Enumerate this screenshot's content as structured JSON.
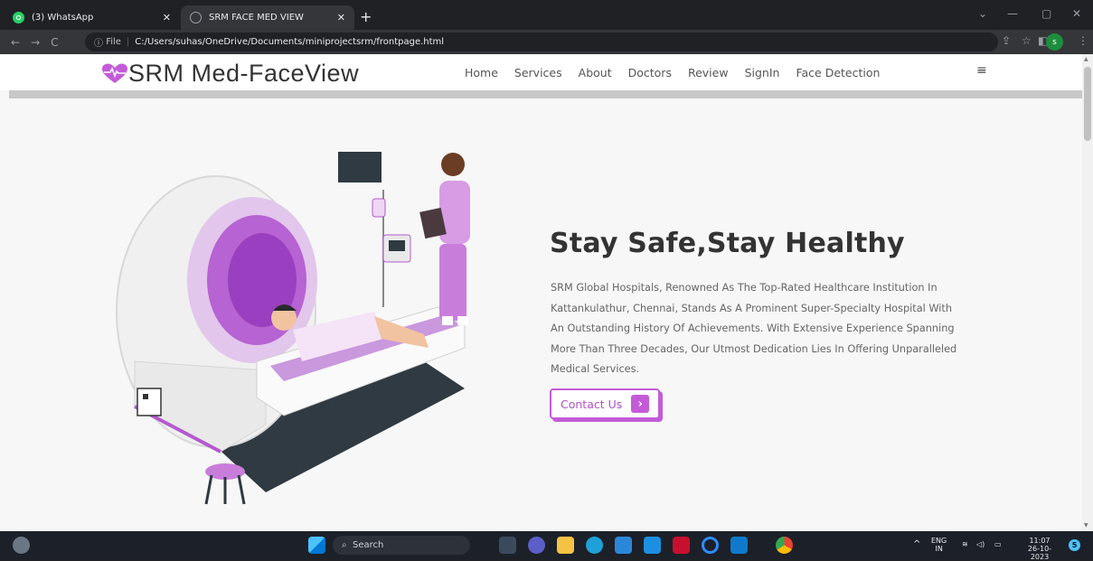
{
  "browser": {
    "tabs": [
      {
        "title": "(3) WhatsApp",
        "active": false
      },
      {
        "title": "SRM FACE MED VIEW",
        "active": true
      }
    ],
    "new_tab": "+",
    "address": {
      "scheme_label": "File",
      "url": "C:/Users/suhas/OneDrive/Documents/miniprojectsrm/frontpage.html"
    },
    "profile_initial": "s"
  },
  "site": {
    "logo_text": "SRM Med-FaceView",
    "nav": [
      "Home",
      "Services",
      "About",
      "Doctors",
      "Review",
      "SignIn",
      "Face Detection"
    ],
    "menu_icon": "≡",
    "hero": {
      "title": "Stay Safe,Stay Healthy",
      "paragraph": "SRM Global Hospitals, Renowned As The Top-Rated Healthcare Institution In Kattankulathur, Chennai, Stands As A Prominent Super-Specialty Hospital With An Outstanding History Of Achievements. With Extensive Experience Spanning More Than Three Decades, Our Utmost Dedication Lies In Offering Unparalleled Medical Services.",
      "cta_label": "Contact Us",
      "cta_arrow": "›"
    }
  },
  "taskbar": {
    "search_label": "Search",
    "language": "ENG",
    "region": "IN",
    "time": "11:07",
    "date": "26-10-2023",
    "notification_count": "5"
  },
  "colors": {
    "accent": "#c35bd8",
    "whatsapp": "#25d366",
    "browser_dark": "#202124"
  }
}
